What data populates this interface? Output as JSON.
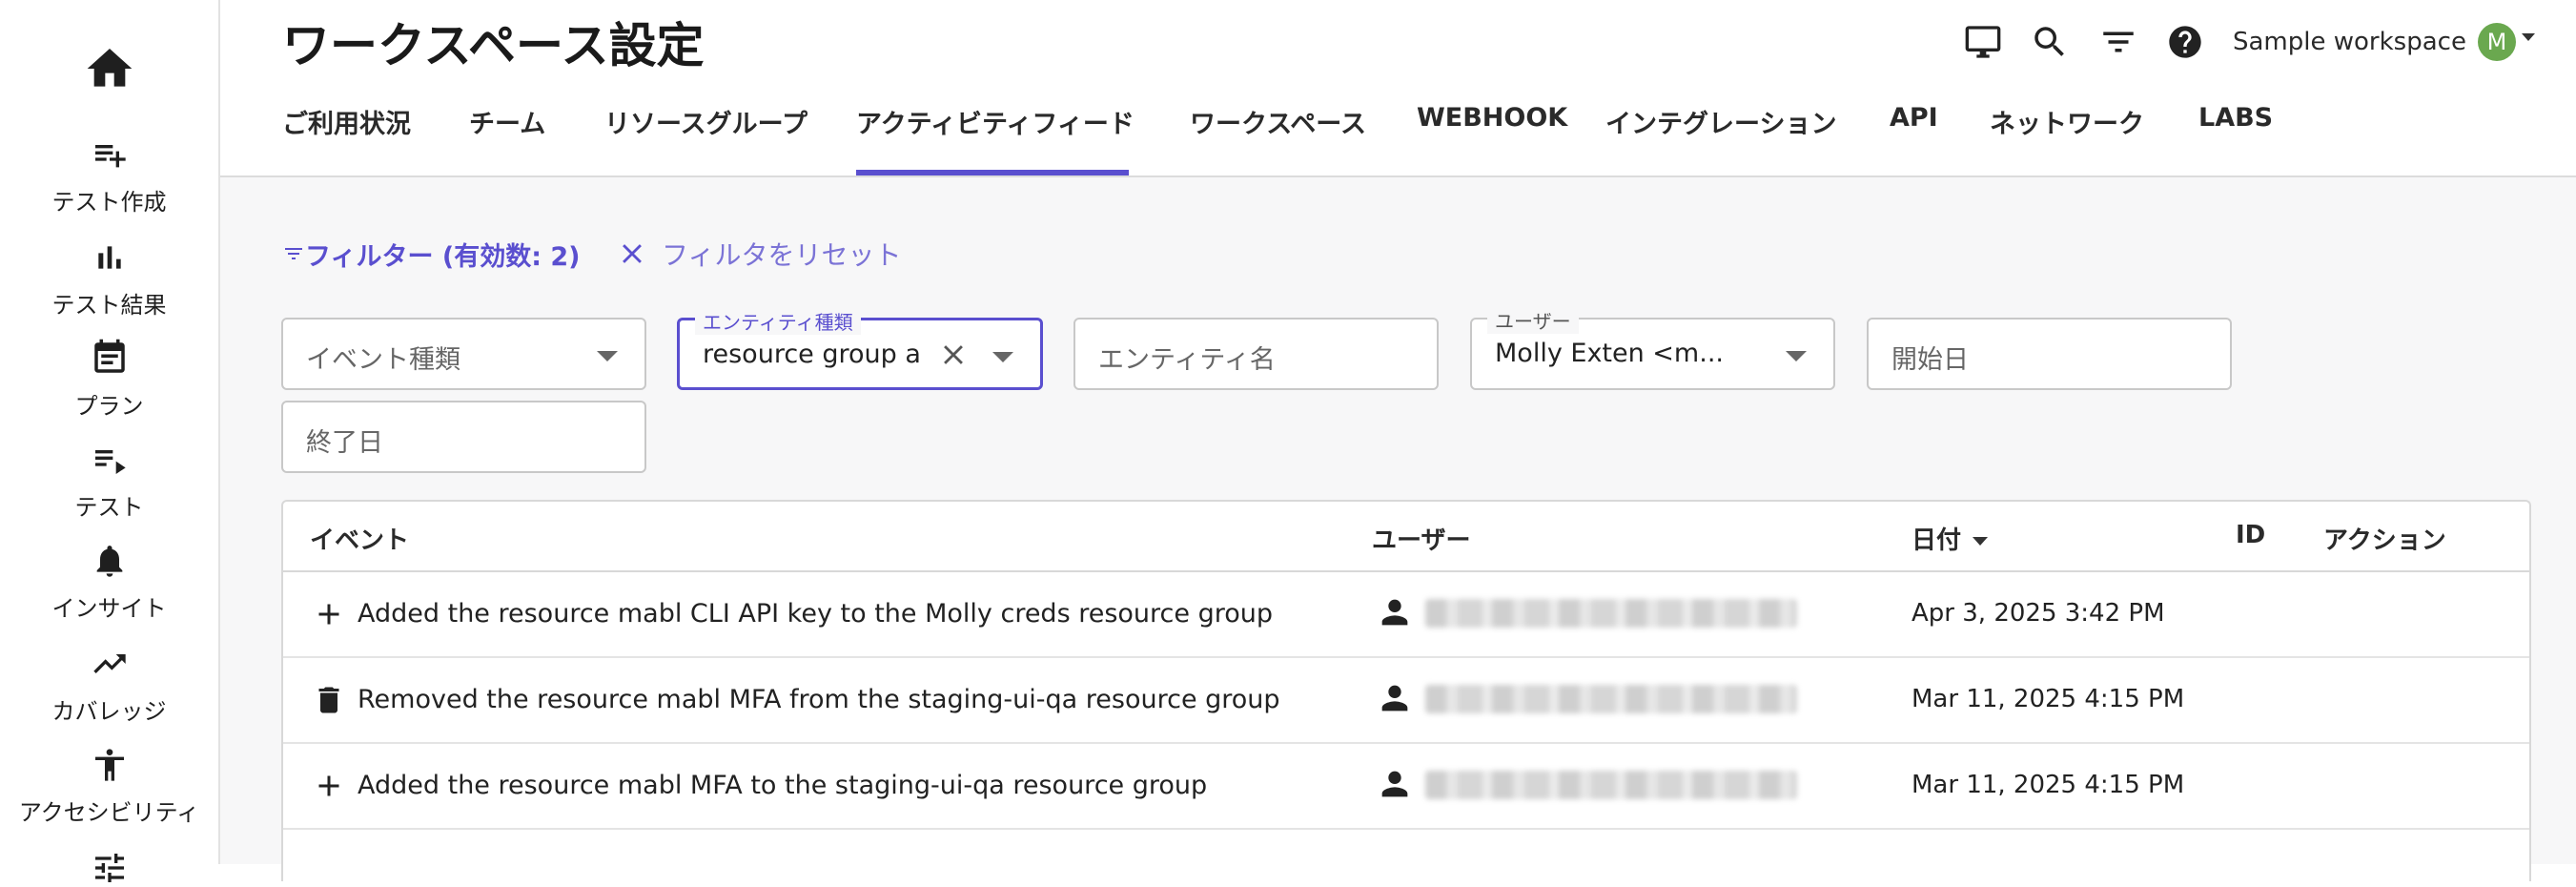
{
  "sidebar": {
    "items": [
      {
        "label": "",
        "icon": "home-icon"
      },
      {
        "label": "テスト作成",
        "icon": "playlist-add-icon"
      },
      {
        "label": "テスト結果",
        "icon": "bar-chart-icon"
      },
      {
        "label": "プラン",
        "icon": "calendar-icon"
      },
      {
        "label": "テスト",
        "icon": "playlist-play-icon"
      },
      {
        "label": "インサイト",
        "icon": "bell-icon"
      },
      {
        "label": "カバレッジ",
        "icon": "trending-up-icon"
      },
      {
        "label": "アクセシビリティ",
        "icon": "accessibility-icon"
      }
    ]
  },
  "header": {
    "title": "ワークスペース設定",
    "workspace_name": "Sample workspace",
    "avatar_initial": "M",
    "avatar_color": "#6aa84f"
  },
  "tabs": [
    {
      "label": "ご利用状況",
      "active": false
    },
    {
      "label": "チーム",
      "active": false
    },
    {
      "label": "リソースグループ",
      "active": false
    },
    {
      "label": "アクティビティフィード",
      "active": true
    },
    {
      "label": "ワークスペース",
      "active": false
    },
    {
      "label": "WEBHOOK",
      "active": false
    },
    {
      "label": "インテグレーション",
      "active": false
    },
    {
      "label": "API",
      "active": false
    },
    {
      "label": "ネットワーク",
      "active": false
    },
    {
      "label": "LABS",
      "active": false
    }
  ],
  "filters": {
    "toggle_label": "フィルター (有効数: 2)",
    "reset_label": "フィルタをリセット",
    "event_type_placeholder": "イベント種類",
    "entity_type_label": "エンティティ種類",
    "entity_type_value": "resource group a",
    "entity_name_placeholder": "エンティティ名",
    "user_label": "ユーザー",
    "user_value": "Molly Exten <m...",
    "start_date_placeholder": "開始日",
    "end_date_placeholder": "終了日"
  },
  "table": {
    "columns": {
      "event": "イベント",
      "user": "ユーザー",
      "date": "日付",
      "id": "ID",
      "action": "アクション"
    },
    "rows": [
      {
        "icon": "plus-icon",
        "event": "Added the resource mabl CLI API key to the Molly creds resource group",
        "date": "Apr 3, 2025 3:42 PM"
      },
      {
        "icon": "trash-icon",
        "event": "Removed the resource mabl MFA from the staging-ui-qa resource group",
        "date": "Mar 11, 2025 4:15 PM"
      },
      {
        "icon": "plus-icon",
        "event": "Added the resource mabl MFA to the staging-ui-qa resource group",
        "date": "Mar 11, 2025 4:15 PM"
      }
    ]
  },
  "colors": {
    "accent": "#5a4fcf",
    "content_bg": "#f7f7f8"
  }
}
